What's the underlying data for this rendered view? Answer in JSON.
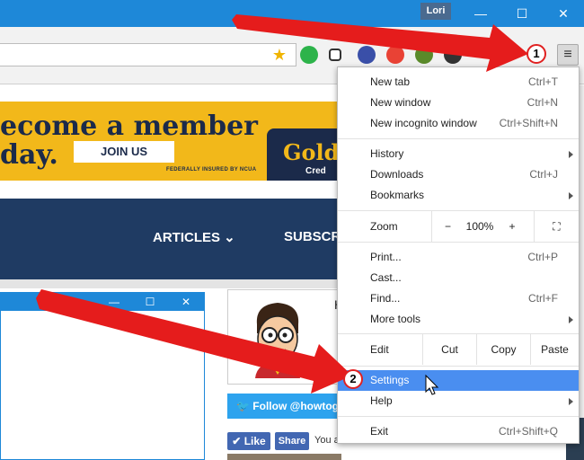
{
  "window": {
    "user_badge": "Lori",
    "minimize_glyph": "—",
    "maximize_glyph": "☐",
    "close_glyph": "✕"
  },
  "toolbar": {
    "star_glyph": "★",
    "menu_glyph": "≡"
  },
  "banner": {
    "line1": "ecome a member",
    "line2": "day.",
    "join_label": "JOIN US",
    "ncua_text": "FEDERALLY INSURED BY NCUA",
    "brand": "Golde",
    "brand_sub": "Cred"
  },
  "nav": {
    "articles": "ARTICLES",
    "subscribe": "SUBSCRIB"
  },
  "inner_window": {
    "minimize_glyph": "—",
    "maximize_glyph": "☐",
    "close_glyph": "✕"
  },
  "social": {
    "card_initial": "H",
    "follow_label": "Follow @howtog",
    "like_label": "Like",
    "share_label": "Share",
    "fb_text": "You and"
  },
  "menu": {
    "new_tab": {
      "label": "New tab",
      "shortcut": "Ctrl+T"
    },
    "new_window": {
      "label": "New window",
      "shortcut": "Ctrl+N"
    },
    "new_incognito": {
      "label": "New incognito window",
      "shortcut": "Ctrl+Shift+N"
    },
    "history": {
      "label": "History"
    },
    "downloads": {
      "label": "Downloads",
      "shortcut": "Ctrl+J"
    },
    "bookmarks": {
      "label": "Bookmarks"
    },
    "zoom": {
      "label": "Zoom",
      "minus": "−",
      "value": "100%",
      "plus": "+",
      "fullscreen": "⛶"
    },
    "print": {
      "label": "Print...",
      "shortcut": "Ctrl+P"
    },
    "cast": {
      "label": "Cast..."
    },
    "find": {
      "label": "Find...",
      "shortcut": "Ctrl+F"
    },
    "more_tools": {
      "label": "More tools"
    },
    "edit": {
      "label": "Edit",
      "cut": "Cut",
      "copy": "Copy",
      "paste": "Paste"
    },
    "settings": {
      "label": "Settings"
    },
    "help": {
      "label": "Help"
    },
    "exit": {
      "label": "Exit",
      "shortcut": "Ctrl+Shift+Q"
    }
  },
  "callouts": {
    "one": "1",
    "two": "2"
  },
  "colors": {
    "titlebar": "#1e88d8",
    "menu_highlight": "#4a8ef0",
    "arrow_red": "#e51c1c"
  }
}
